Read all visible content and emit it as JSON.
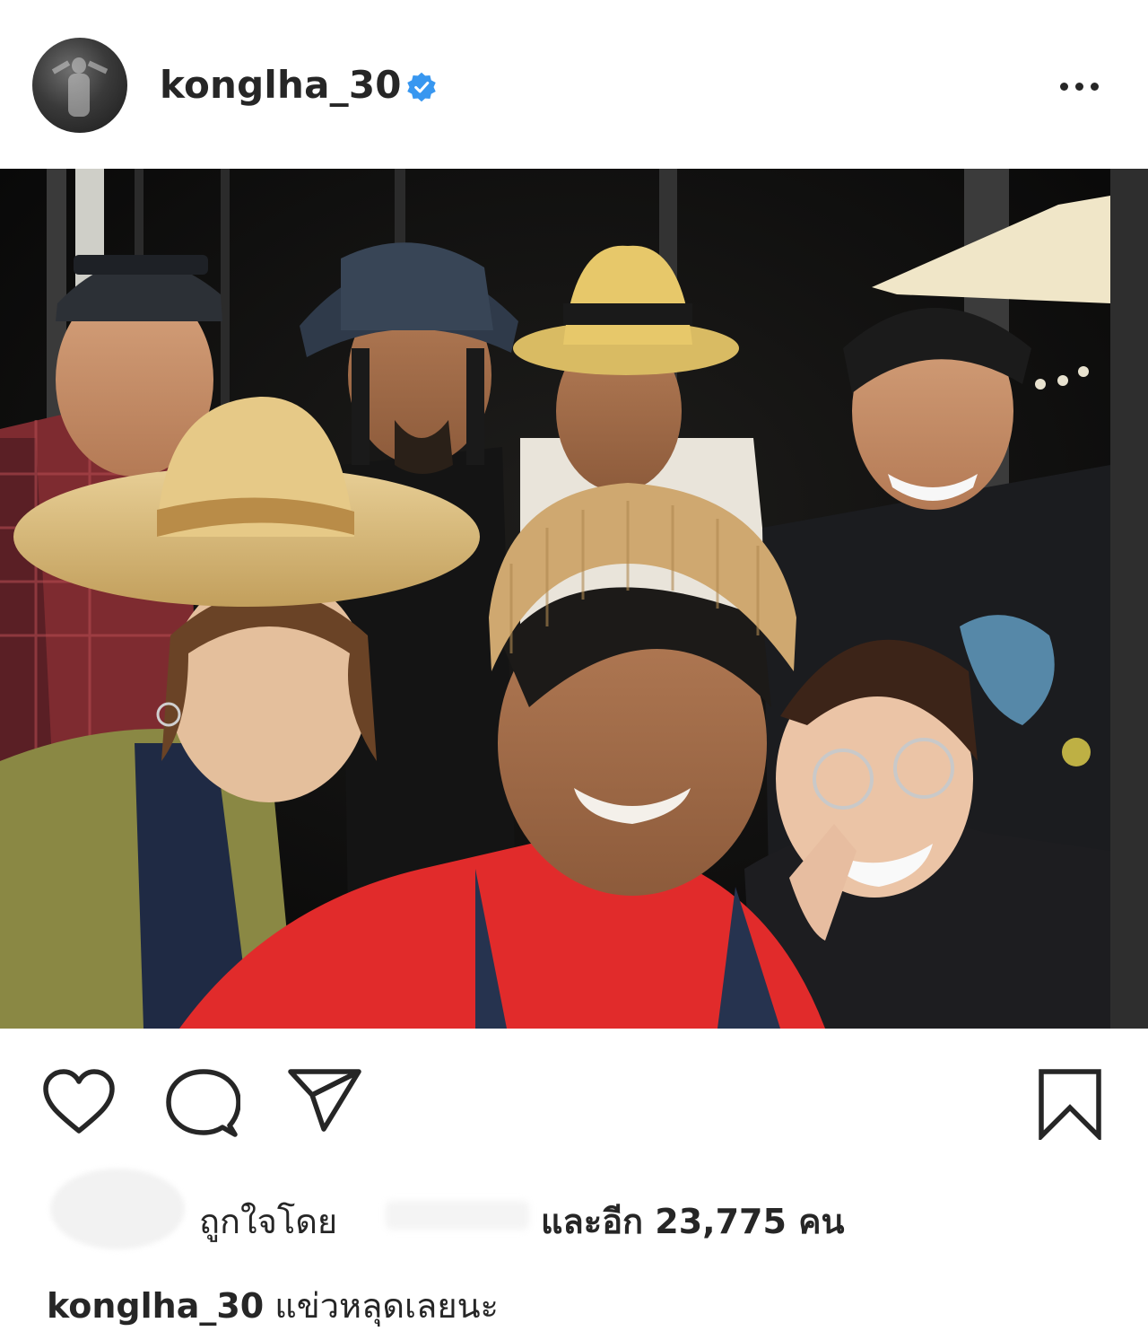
{
  "post": {
    "username": "konglha_30",
    "verified": true,
    "more_icon": "more-horizontal-icon",
    "verified_icon": "verified-badge-icon"
  },
  "photo": {
    "caption_alt": ""
  },
  "actions": {
    "like_icon": "heart-icon",
    "comment_icon": "comment-icon",
    "share_icon": "send-icon",
    "save_icon": "bookmark-icon"
  },
  "likes": {
    "liked_by_label": "ถูกใจโดย",
    "and_others_label": "และอีก 23,775 คน"
  },
  "caption": {
    "username": "konglha_30",
    "text": "แข่วหลุดเลยนะ"
  },
  "colors": {
    "verified_blue": "#3897f0",
    "text": "#262626"
  }
}
